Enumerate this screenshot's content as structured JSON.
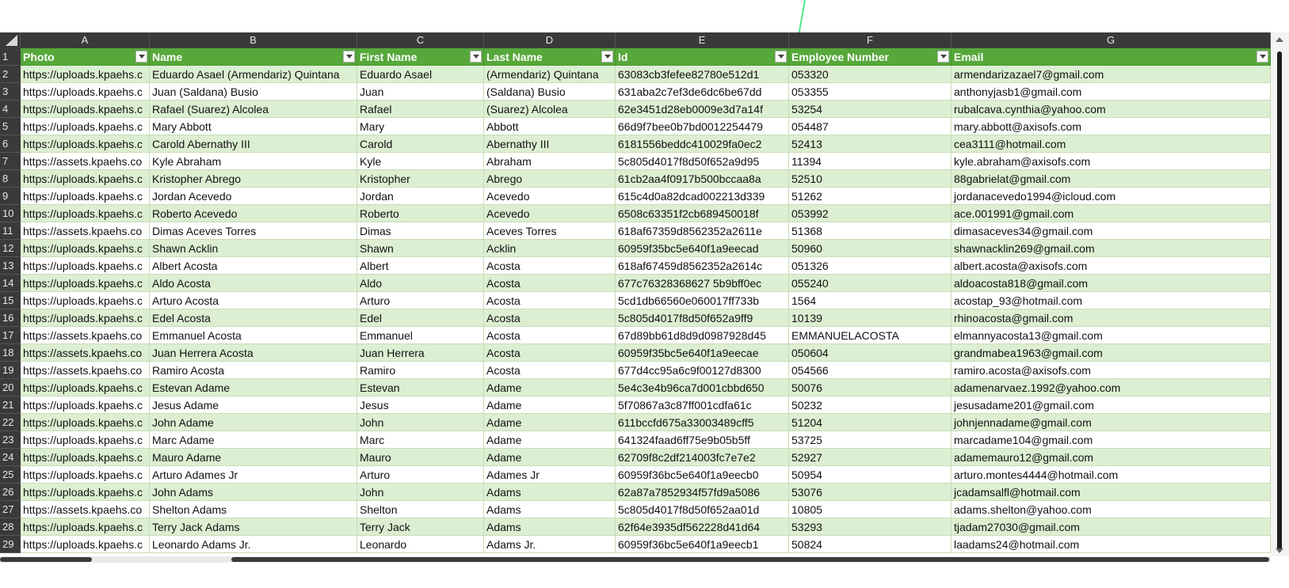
{
  "columns": [
    "A",
    "B",
    "C",
    "D",
    "E",
    "F",
    "G"
  ],
  "headers": [
    "Photo",
    "Name",
    "First Name",
    "Last Name",
    "Id",
    "Employee Number",
    "Email"
  ],
  "row_numbers": [
    "1",
    "2",
    "3",
    "4",
    "5",
    "6",
    "7",
    "8",
    "9",
    "10",
    "11",
    "12",
    "13",
    "14",
    "15",
    "16",
    "17",
    "18",
    "19",
    "20",
    "21",
    "22",
    "23",
    "24",
    "25",
    "26",
    "27",
    "28",
    "29"
  ],
  "rows": [
    [
      "https://uploads.kpaehs.c",
      "Eduardo Asael (Armendariz) Quintana",
      "Eduardo Asael",
      "(Armendariz) Quintana",
      "63083cb3fefee82780e512d1",
      "053320",
      "armendarizazael7@gmail.com"
    ],
    [
      "https://uploads.kpaehs.c",
      "Juan (Saldana) Busio",
      "Juan",
      "(Saldana) Busio",
      "631aba2c7ef3de6dc6be67dd",
      "053355",
      "anthonyjasb1@gmail.com"
    ],
    [
      "https://uploads.kpaehs.c",
      "Rafael (Suarez) Alcolea",
      "Rafael",
      "(Suarez) Alcolea",
      "62e3451d28eb0009e3d7a14f",
      "53254",
      "rubalcava.cynthia@yahoo.com"
    ],
    [
      "https://uploads.kpaehs.c",
      "Mary Abbott",
      "Mary",
      "Abbott",
      "66d9f7bee0b7bd0012254479",
      "054487",
      "mary.abbott@axisofs.com"
    ],
    [
      "https://uploads.kpaehs.c",
      "Carold Abernathy III",
      "Carold",
      "Abernathy III",
      "6181556beddc410029fa0ec2",
      "52413",
      "cea3111@hotmail.com"
    ],
    [
      "https://assets.kpaehs.co",
      "Kyle Abraham",
      "Kyle",
      "Abraham",
      "5c805d4017f8d50f652a9d95",
      "11394",
      "kyle.abraham@axisofs.com"
    ],
    [
      "https://uploads.kpaehs.c",
      "Kristopher Abrego",
      "Kristopher",
      "Abrego",
      "61cb2aa4f0917b500bccaa8a",
      "52510",
      "88gabrielat@gmail.com"
    ],
    [
      "https://uploads.kpaehs.c",
      "Jordan Acevedo",
      "Jordan",
      "Acevedo",
      "615c4d0a82dcad002213d339",
      "51262",
      "jordanacevedo1994@icloud.com"
    ],
    [
      "https://uploads.kpaehs.c",
      "Roberto Acevedo",
      "Roberto",
      "Acevedo",
      "6508c63351f2cb689450018f",
      "053992",
      "ace.001991@gmail.com"
    ],
    [
      "https://assets.kpaehs.co",
      "Dimas Aceves Torres",
      "Dimas",
      "Aceves Torres",
      "618af67359d8562352a2611e",
      "51368",
      "dimasaceves34@gmail.com"
    ],
    [
      "https://uploads.kpaehs.c",
      "Shawn Acklin",
      "Shawn",
      "Acklin",
      "60959f35bc5e640f1a9eecad",
      "50960",
      "shawnacklin269@gmail.com"
    ],
    [
      "https://uploads.kpaehs.c",
      "Albert Acosta",
      "Albert",
      "Acosta",
      "618af67459d8562352a2614c",
      "051326",
      "albert.acosta@axisofs.com"
    ],
    [
      "https://uploads.kpaehs.c",
      "Aldo Acosta",
      "Aldo",
      "Acosta",
      "677c76328368627 5b9bff0ec",
      "055240",
      "aldoacosta818@gmail.com"
    ],
    [
      "https://uploads.kpaehs.c",
      "Arturo Acosta",
      "Arturo",
      "Acosta",
      "5cd1db66560e060017ff733b",
      "1564",
      "acostap_93@hotmail.com"
    ],
    [
      "https://uploads.kpaehs.c",
      "Edel Acosta",
      "Edel",
      "Acosta",
      "5c805d4017f8d50f652a9ff9",
      "10139",
      "rhinoacosta@gmail.com"
    ],
    [
      "https://assets.kpaehs.co",
      "Emmanuel Acosta",
      "Emmanuel",
      "Acosta",
      "67d89bb61d8d9d0987928d45",
      "EMMANUELACOSTA",
      "elmannyacosta13@gmail.com"
    ],
    [
      "https://assets.kpaehs.co",
      "Juan Herrera Acosta",
      "Juan Herrera",
      "Acosta",
      "60959f35bc5e640f1a9eecae",
      "050604",
      "grandmabea1963@gmail.com"
    ],
    [
      "https://assets.kpaehs.co",
      "Ramiro Acosta",
      "Ramiro",
      "Acosta",
      "677d4cc95a6c9f00127d8300",
      "054566",
      "ramiro.acosta@axisofs.com"
    ],
    [
      "https://uploads.kpaehs.c",
      "Estevan Adame",
      "Estevan",
      "Adame",
      "5e4c3e4b96ca7d001cbbd650",
      "50076",
      "adamenarvaez.1992@yahoo.com"
    ],
    [
      "https://uploads.kpaehs.c",
      "Jesus Adame",
      "Jesus",
      "Adame",
      "5f70867a3c87ff001cdfa61c",
      "50232",
      "jesusadame201@gmail.com"
    ],
    [
      "https://uploads.kpaehs.c",
      "John Adame",
      "John",
      "Adame",
      "611bccfd675a33003489cff5",
      "51204",
      "johnjennadame@gmail.com"
    ],
    [
      "https://uploads.kpaehs.c",
      "Marc Adame",
      "Marc",
      "Adame",
      "641324faad6ff75e9b05b5ff",
      "53725",
      "marcadame104@gmail.com"
    ],
    [
      "https://uploads.kpaehs.c",
      "Mauro Adame",
      "Mauro",
      "Adame",
      "62709f8c2df214003fc7e7e2",
      "52927",
      "adamemauro12@gmail.com"
    ],
    [
      "https://uploads.kpaehs.c",
      "Arturo Adames Jr",
      "Arturo",
      "Adames Jr",
      "60959f36bc5e640f1a9eecb0",
      "50954",
      "arturo.montes4444@hotmail.com"
    ],
    [
      "https://uploads.kpaehs.c",
      "John Adams",
      "John",
      "Adams",
      "62a87a7852934f57fd9a5086",
      "53076",
      "jcadamsalfl@hotmail.com"
    ],
    [
      "https://assets.kpaehs.co",
      "Shelton Adams",
      "Shelton",
      "Adams",
      "5c805d4017f8d50f652aa01d",
      "10805",
      "adams.shelton@yahoo.com"
    ],
    [
      "https://uploads.kpaehs.c",
      "Terry Jack Adams",
      "Terry Jack",
      "Adams",
      "62f64e3935df562228d41d64",
      "53293",
      "tjadam27030@gmail.com"
    ],
    [
      "https://uploads.kpaehs.c",
      "Leonardo Adams Jr.",
      "Leonardo",
      "Adams Jr.",
      "60959f36bc5e640f1a9eecb1",
      "50824",
      "laadams24@hotmail.com"
    ]
  ],
  "colors": {
    "header_green": "#56a83a",
    "band_green": "#dcefd2",
    "gutter_dark": "#3a3a3a",
    "pointer_line": "#4ee88a"
  }
}
